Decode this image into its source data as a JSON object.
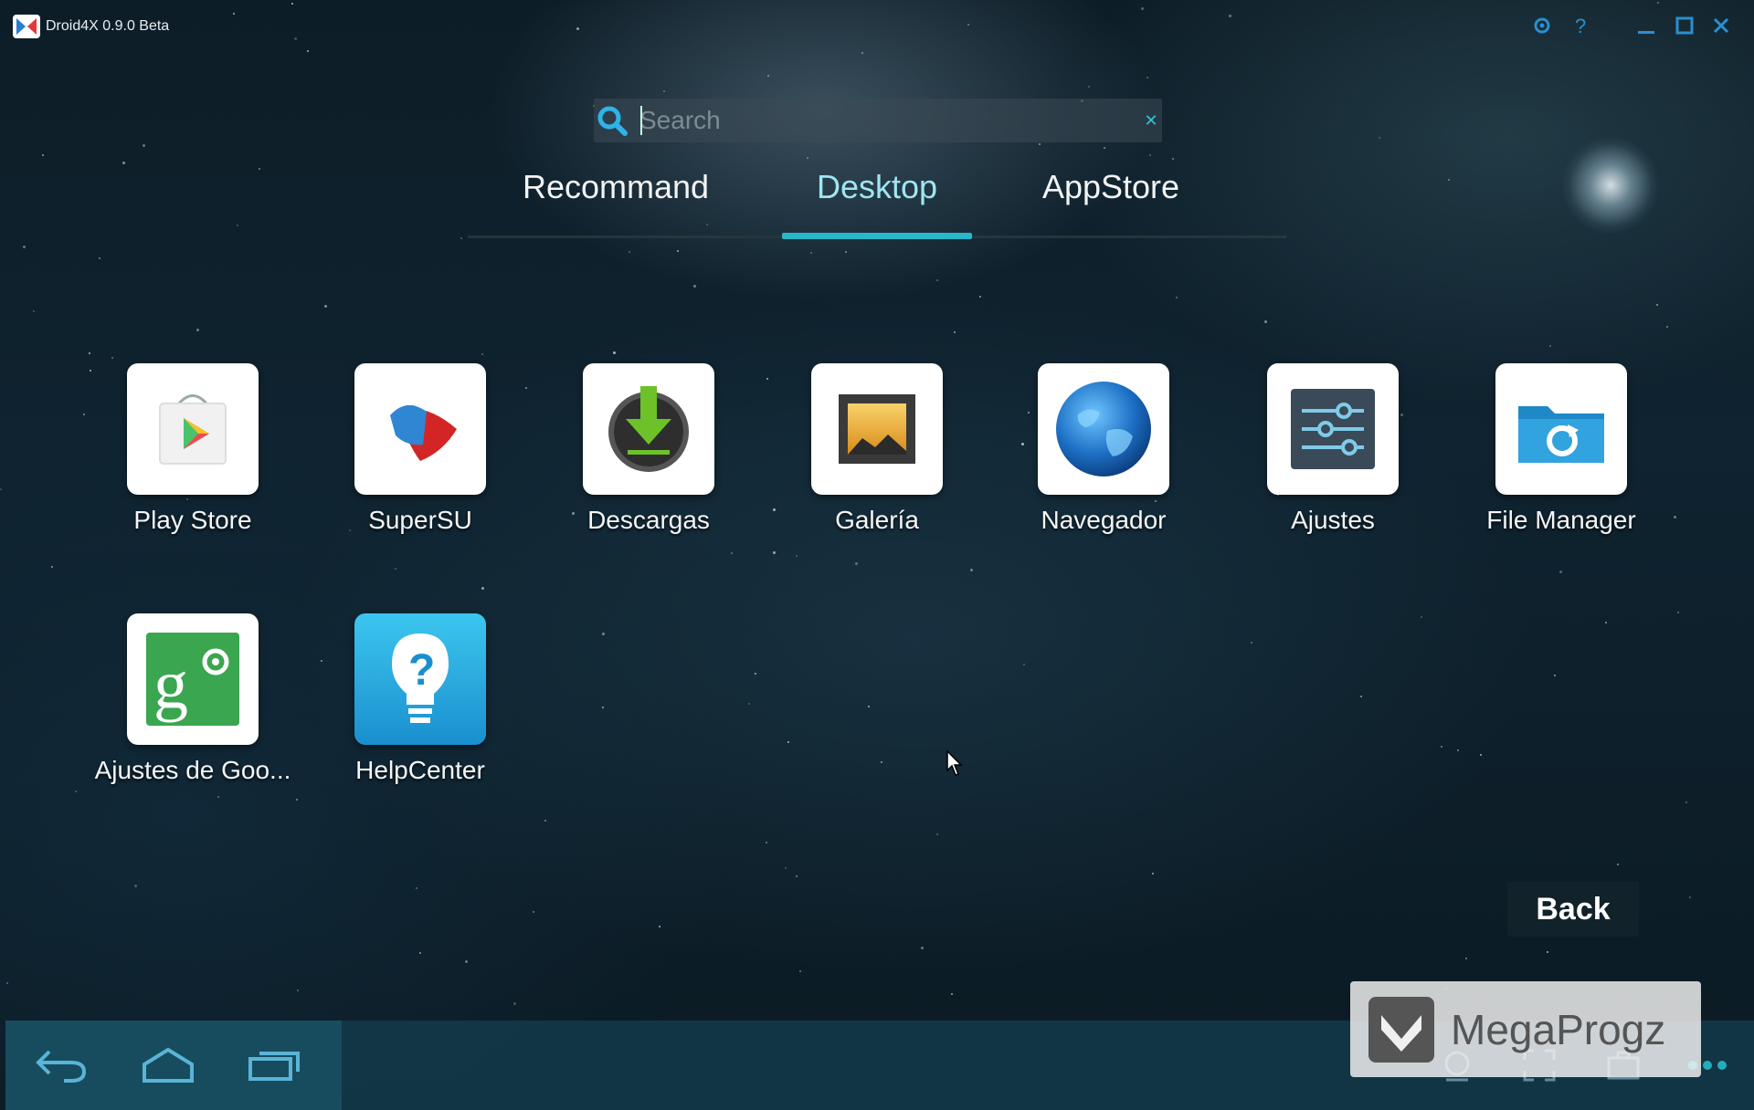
{
  "window": {
    "title": "Droid4X 0.9.0 Beta",
    "controls": [
      "settings-icon",
      "help-icon",
      "minimize-icon",
      "maximize-icon",
      "close-icon"
    ]
  },
  "search": {
    "placeholder": "Search",
    "value": ""
  },
  "tabs": [
    {
      "label": "Recommand",
      "active": false
    },
    {
      "label": "Desktop",
      "active": true
    },
    {
      "label": "AppStore",
      "active": false
    }
  ],
  "apps": [
    {
      "label": "Play Store",
      "icon": "play-store-icon"
    },
    {
      "label": "SuperSU",
      "icon": "supersu-icon"
    },
    {
      "label": "Descargas",
      "icon": "download-icon"
    },
    {
      "label": "Galería",
      "icon": "gallery-icon"
    },
    {
      "label": "Navegador",
      "icon": "globe-icon"
    },
    {
      "label": "Ajustes",
      "icon": "settings-sliders-icon"
    },
    {
      "label": "File Manager",
      "icon": "folder-refresh-icon"
    },
    {
      "label": "Ajustes de Goo...",
      "icon": "google-settings-icon"
    },
    {
      "label": "HelpCenter",
      "icon": "lightbulb-question-icon"
    }
  ],
  "back_button": {
    "label": "Back"
  },
  "navbar": {
    "buttons": [
      "back-arrow-icon",
      "home-icon",
      "recent-apps-icon"
    ],
    "right_icons": [
      "location-icon",
      "fullscreen-icon",
      "keyboard-icon",
      "more-icon"
    ]
  },
  "watermark": {
    "text": "MegaProgz"
  },
  "colors": {
    "accent": "#27b8c9",
    "background": "#0f2330",
    "navbar": "#14404f"
  }
}
